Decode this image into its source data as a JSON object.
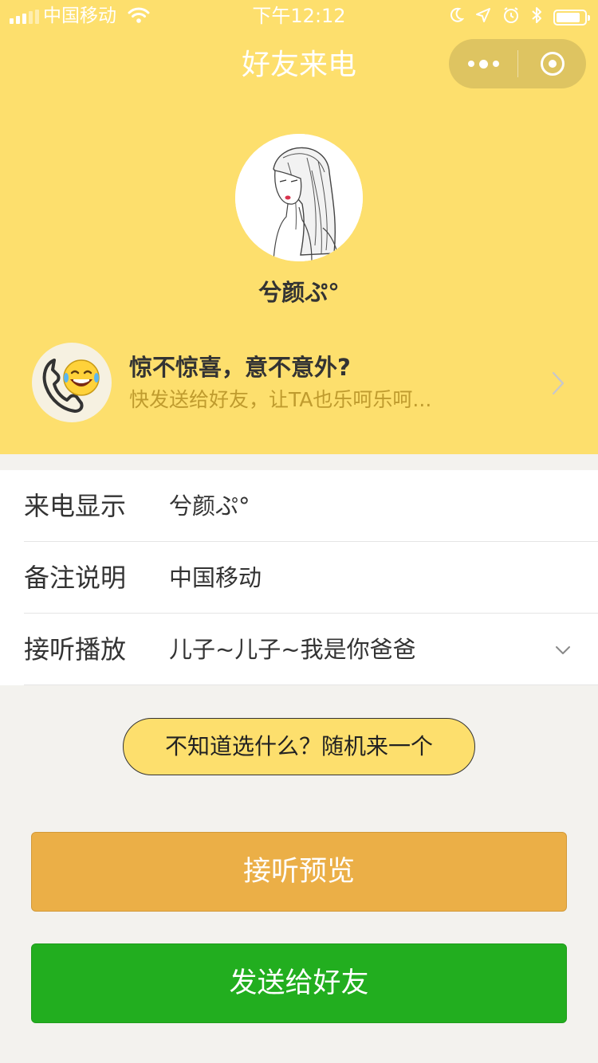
{
  "status_bar": {
    "carrier": "中国移动",
    "time": "下午12:12"
  },
  "nav": {
    "title": "好友来电"
  },
  "profile": {
    "nickname": "兮颜ぷ°"
  },
  "promo": {
    "title": "惊不惊喜，意不意外?",
    "subtitle": "快发送给好友，让TA也乐呵乐呵..."
  },
  "form": {
    "rows": [
      {
        "label": "来电显示",
        "value": "兮颜ぷ°"
      },
      {
        "label": "备注说明",
        "value": "中国移动"
      },
      {
        "label": "接听播放",
        "value": "儿子~儿子~我是你爸爸"
      }
    ]
  },
  "buttons": {
    "random": "不知道选什么？随机来一个",
    "preview": "接听预览",
    "send": "发送给好友"
  },
  "colors": {
    "header_bg": "#fddf6d",
    "preview_bg": "#ebaf47",
    "send_bg": "#22ae1f",
    "promo_subtitle": "#bf9b2e"
  },
  "icons": {
    "wifi": "wifi-icon",
    "moon": "moon-icon",
    "location": "location-arrow-icon",
    "alarm": "alarm-icon",
    "bluetooth": "bluetooth-icon",
    "battery": "battery-icon",
    "more": "more-dots-icon",
    "close": "close-circle-icon",
    "promo": "laughing-phone-icon",
    "chevron_right": "chevron-right-icon",
    "chevron_down": "chevron-down-icon"
  },
  "battery_level": 0.85
}
